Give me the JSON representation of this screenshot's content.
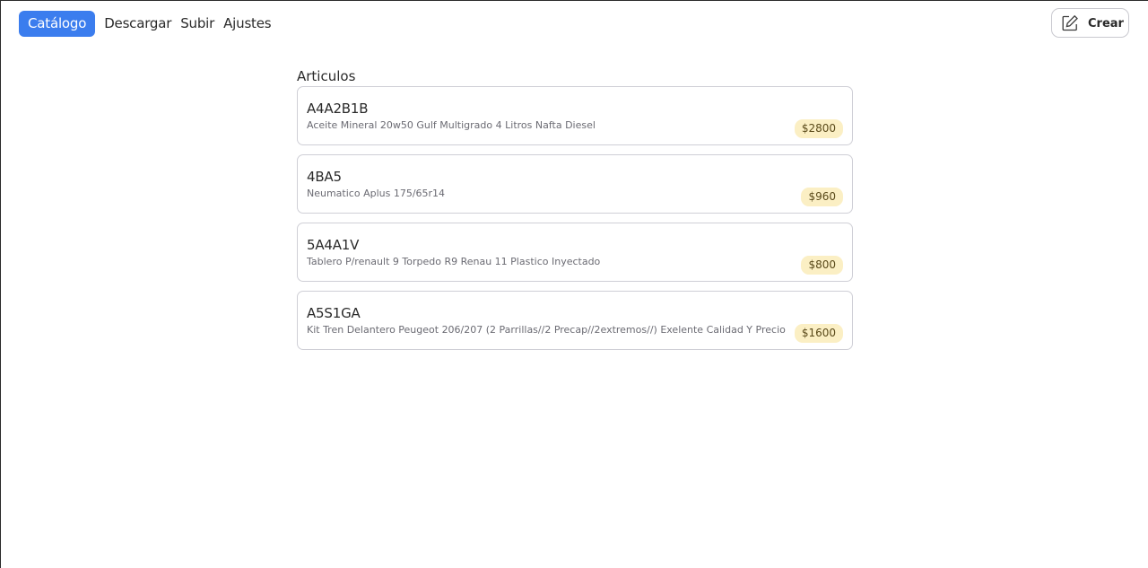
{
  "nav": {
    "items": [
      {
        "label": "Catálogo",
        "active": true
      },
      {
        "label": "Descargar",
        "active": false
      },
      {
        "label": "Subir",
        "active": false
      },
      {
        "label": "Ajustes",
        "active": false
      }
    ]
  },
  "header": {
    "create_label": "Crear",
    "create_icon": "edit-icon"
  },
  "main": {
    "section_title": "Articulos",
    "articles": [
      {
        "code": "A4A2B1B",
        "description": "Aceite Mineral 20w50 Gulf Multigrado 4 Litros Nafta Diesel",
        "price": "$2800"
      },
      {
        "code": "4BA5",
        "description": "Neumatico Aplus 175/65r14",
        "price": "$960"
      },
      {
        "code": "5A4A1V",
        "description": "Tablero P/renault 9 Torpedo R9 Renau 11 Plastico Inyectado",
        "price": "$800"
      },
      {
        "code": "A5S1GA",
        "description": "Kit Tren Delantero Peugeot 206/207 (2 Parrillas//2 Precap//2extremos//) Exelente Calidad Y Precio",
        "price": "$1600"
      }
    ]
  },
  "colors": {
    "accent": "#3b7dee",
    "price_badge_bg": "#fbefc4",
    "card_border": "#cfcfd6"
  }
}
